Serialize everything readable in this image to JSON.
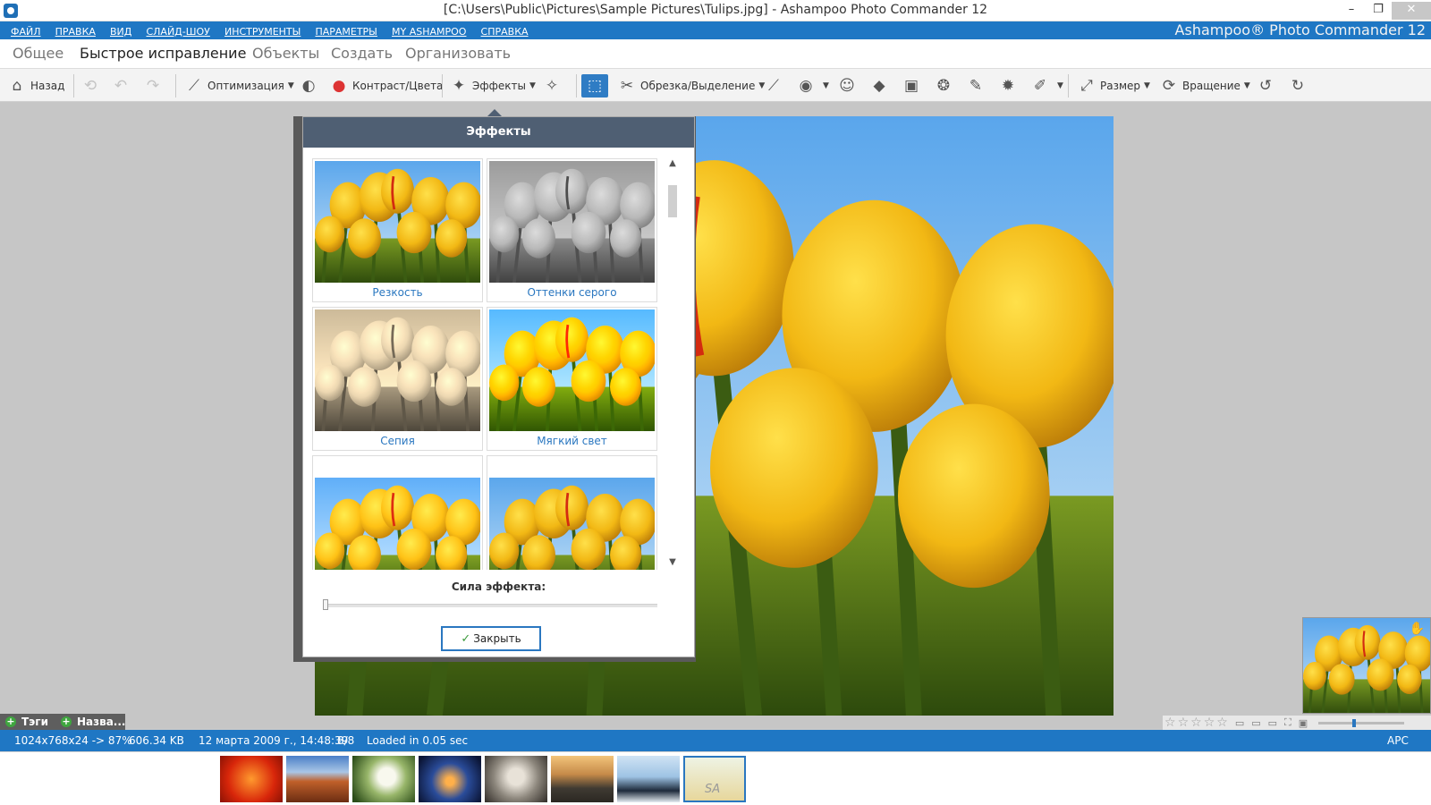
{
  "window": {
    "title": "[C:\\Users\\Public\\Pictures\\Sample Pictures\\Tulips.jpg] - Ashampoo Photo Commander 12",
    "minimize": "–",
    "maximize": "❐",
    "close": "✕"
  },
  "menu": {
    "items": [
      "ФАЙЛ",
      "ПРАВКА",
      "ВИД",
      "СЛАЙД-ШОУ",
      "ИНСТРУМЕНТЫ",
      "ПАРАМЕТРЫ",
      "MY ASHAMPOO",
      "СПРАВКА"
    ],
    "brand": "Ashampoo® Photo Commander 12"
  },
  "tabs": [
    {
      "label": "Общее",
      "active": false
    },
    {
      "label": "Быстрое исправление",
      "active": true
    },
    {
      "label": "Объекты",
      "active": false
    },
    {
      "label": "Создать",
      "active": false
    },
    {
      "label": "Организовать",
      "active": false
    }
  ],
  "toolbar": {
    "back": "Назад",
    "optimize": "Оптимизация",
    "contrast": "Контраст/Цвета",
    "effects": "Эффекты",
    "crop": "Обрезка/Выделение",
    "size": "Размер",
    "rotate": "Вращение"
  },
  "panel": {
    "title": "Эффекты",
    "effects": [
      "Резкость",
      "Оттенки серого",
      "Сепия",
      "Мягкий свет",
      "",
      ""
    ],
    "strength_label": "Сила эффекта:",
    "strength": 0,
    "close_label": "Закрыть"
  },
  "tags": {
    "tags_label": "Тэги",
    "name_label": "Назва..."
  },
  "status": {
    "dimensions": "1024x768x24 -> 87%",
    "filesize": "606.34 KB",
    "date": "12 марта 2009 г., 14:48:39",
    "index": "8/8",
    "loaded": "Loaded in 0.05 sec",
    "kbd": "APC"
  },
  "filmstrip": {
    "count": 8,
    "active_index": 7,
    "active_caption": "SA"
  },
  "colors": {
    "accent": "#1f77c4",
    "panel_header": "#4f5f73",
    "caption": "#2a77c0"
  }
}
